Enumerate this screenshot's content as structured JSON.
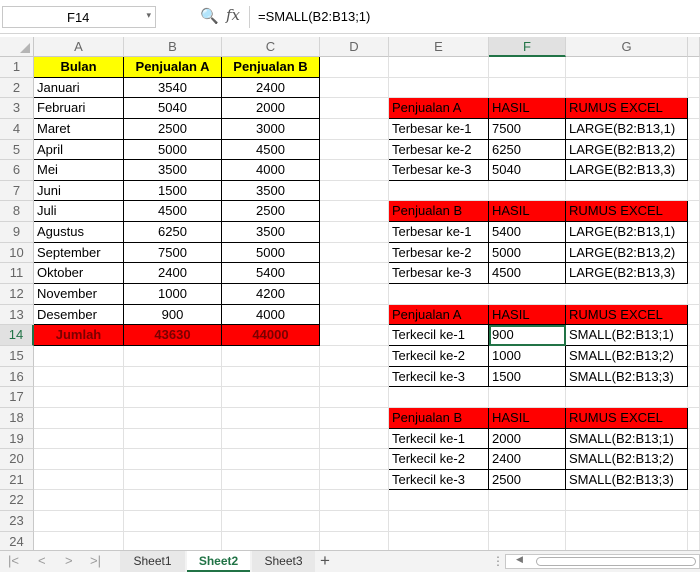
{
  "formula_bar": {
    "name_box": "F14",
    "name_box_caret": "▾",
    "zoom_icon": "🔍",
    "fx_label": "fx",
    "formula": "=SMALL(B2:B13;1)"
  },
  "columns": [
    "A",
    "B",
    "C",
    "D",
    "E",
    "F",
    "G"
  ],
  "rows": [
    "1",
    "2",
    "3",
    "4",
    "5",
    "6",
    "7",
    "8",
    "9",
    "10",
    "11",
    "12",
    "13",
    "14",
    "15",
    "16",
    "17",
    "18",
    "19",
    "20",
    "21",
    "22",
    "23",
    "24"
  ],
  "main_table": {
    "headers": [
      "Bulan",
      "Penjualan A",
      "Penjualan B"
    ],
    "data": [
      [
        "Januari",
        "3540",
        "2400"
      ],
      [
        "Februari",
        "5040",
        "2000"
      ],
      [
        "Maret",
        "2500",
        "3000"
      ],
      [
        "April",
        "5000",
        "4500"
      ],
      [
        "Mei",
        "3500",
        "4000"
      ],
      [
        "Juni",
        "1500",
        "3500"
      ],
      [
        "Juli",
        "4500",
        "2500"
      ],
      [
        "Agustus",
        "6250",
        "3500"
      ],
      [
        "September",
        "7500",
        "5000"
      ],
      [
        "Oktober",
        "2400",
        "5400"
      ],
      [
        "November",
        "1000",
        "4200"
      ],
      [
        "Desember",
        "900",
        "4000"
      ]
    ],
    "total": [
      "Jumlah",
      "43630",
      "44000"
    ]
  },
  "side_tables": [
    {
      "headers": [
        "Penjualan A",
        "HASIL",
        "RUMUS EXCEL"
      ],
      "rows": [
        [
          "Terbesar ke-1",
          "7500",
          "LARGE(B2:B13,1)"
        ],
        [
          "Terbesar ke-2",
          "6250",
          "LARGE(B2:B13,2)"
        ],
        [
          "Terbesar ke-3",
          "5040",
          "LARGE(B2:B13,3)"
        ]
      ]
    },
    {
      "headers": [
        "Penjualan B",
        "HASIL",
        "RUMUS EXCEL"
      ],
      "rows": [
        [
          "Terbesar ke-1",
          "5400",
          "LARGE(B2:B13,1)"
        ],
        [
          "Terbesar ke-2",
          "5000",
          "LARGE(B2:B13,2)"
        ],
        [
          "Terbesar ke-3",
          "4500",
          "LARGE(B2:B13,3)"
        ]
      ]
    },
    {
      "headers": [
        "Penjualan A",
        "HASIL",
        "RUMUS EXCEL"
      ],
      "rows": [
        [
          "Terkecil ke-1",
          "900",
          "SMALL(B2:B13;1)"
        ],
        [
          "Terkecil ke-2",
          "1000",
          "SMALL(B2:B13;2)"
        ],
        [
          "Terkecil ke-3",
          "1500",
          "SMALL(B2:B13;3)"
        ]
      ]
    },
    {
      "headers": [
        "Penjualan B",
        "HASIL",
        "RUMUS EXCEL"
      ],
      "rows": [
        [
          "Terkecil ke-1",
          "2000",
          "SMALL(B2:B13;1)"
        ],
        [
          "Terkecil ke-2",
          "2400",
          "SMALL(B2:B13;2)"
        ],
        [
          "Terkecil ke-3",
          "2500",
          "SMALL(B2:B13;3)"
        ]
      ]
    }
  ],
  "active_cell": "F14",
  "sheet_tabs": {
    "tabs": [
      "Sheet1",
      "Sheet2",
      "Sheet3"
    ],
    "active": "Sheet2",
    "nav_first": "|<",
    "nav_prev": "<",
    "nav_next": ">",
    "nav_last": ">|",
    "add_label": "+"
  },
  "colors": {
    "header_yellow": "#ffff00",
    "highlight_red": "#ff0000",
    "excel_green": "#217346"
  }
}
